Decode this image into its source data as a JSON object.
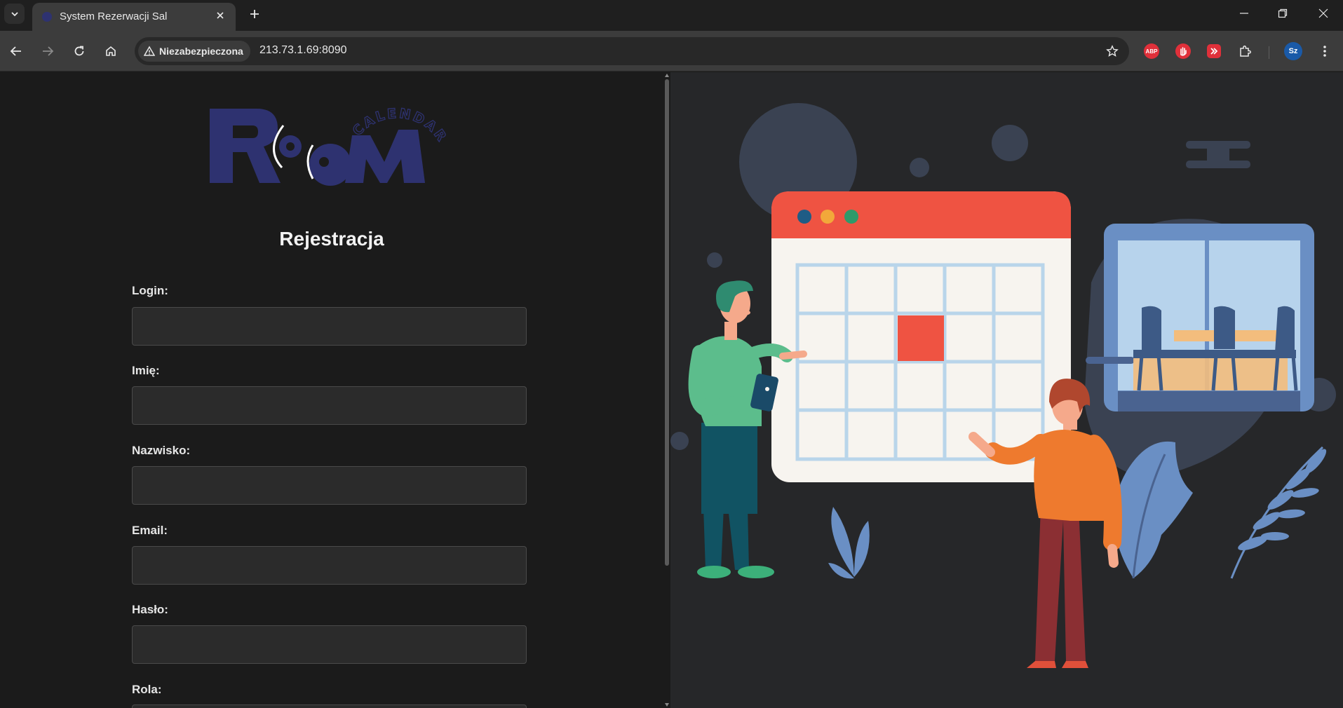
{
  "browser": {
    "tab_title": "System Rezerwacji Sal",
    "security_label": "Niezabezpieczona",
    "url": "213.73.1.69:8090",
    "profile_initials": "Sz",
    "extensions": [
      "adblock-plus-icon",
      "stop-hand-icon",
      "video-downloader-icon",
      "extensions-puzzle-icon"
    ],
    "abp_badge": "ABP"
  },
  "logo": {
    "word": "RooM",
    "arc_text": "CALENDAR",
    "color": "#2e3270"
  },
  "form": {
    "title": "Rejestracja",
    "fields": [
      {
        "label": "Login:",
        "value": ""
      },
      {
        "label": "Imię:",
        "value": ""
      },
      {
        "label": "Nazwisko:",
        "value": ""
      },
      {
        "label": "Email:",
        "value": ""
      },
      {
        "label": "Hasło:",
        "value": ""
      },
      {
        "label": "Rola:",
        "value": ""
      }
    ]
  },
  "colors": {
    "page_bg": "#1b1b1b",
    "illustration_bg": "#262729",
    "calendar_header": "#ef5342",
    "highlighted_day": "#ef5342"
  }
}
